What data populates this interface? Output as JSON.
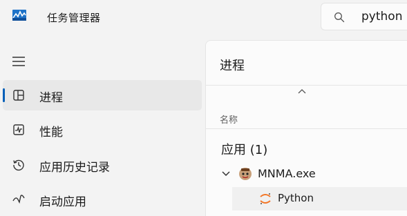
{
  "app": {
    "title": "任务管理器"
  },
  "search": {
    "value": "python"
  },
  "sidebar": {
    "items": [
      {
        "label": "进程",
        "active": true,
        "icon": "processes-icon"
      },
      {
        "label": "性能",
        "active": false,
        "icon": "performance-icon"
      },
      {
        "label": "应用历史记录",
        "active": false,
        "icon": "app-history-icon"
      },
      {
        "label": "启动应用",
        "active": false,
        "icon": "startup-apps-icon"
      }
    ]
  },
  "main": {
    "title": "进程",
    "column_name": "名称",
    "group_label": "应用 (1)",
    "process": {
      "name": "MNMA.exe",
      "expanded": true
    },
    "child": {
      "name": "Python"
    }
  },
  "colors": {
    "accent": "#005fb8",
    "background": "#f3f3f3",
    "panel": "#fbfbfb"
  }
}
